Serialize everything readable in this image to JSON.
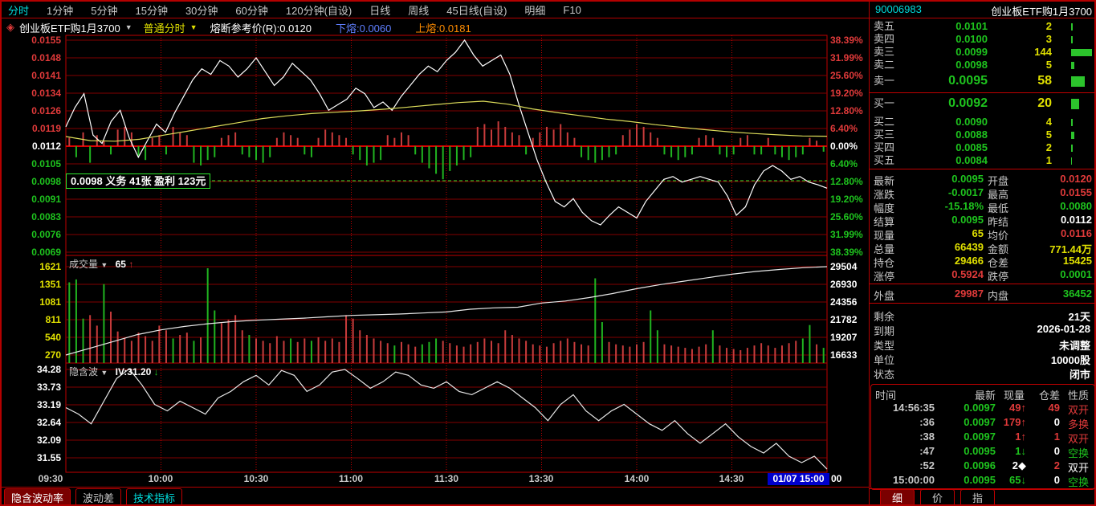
{
  "window": {
    "code": "90006983",
    "name": "创业板ETF购1月3700"
  },
  "menu": {
    "active": "分时",
    "items": [
      "分时",
      "1分钟",
      "5分钟",
      "15分钟",
      "30分钟",
      "60分钟",
      "120分钟(自设)",
      "日线",
      "周线",
      "45日线(自设)",
      "明细",
      "F10"
    ]
  },
  "icons": {
    "dropdown": "▼",
    "diamond_marker": "◈",
    "up": "↑",
    "down": "↓",
    "flat": "◆"
  },
  "chart_header": {
    "symbol": "创业板ETF购1月3700",
    "mode": "普通分时",
    "fuse_ref": "熔断参考价(R):0.0120",
    "lower_fuse": "下熔:0.0060",
    "upper_fuse": "上熔:0.0181"
  },
  "tooltip_text": "0.0098 义务 41张 盈利 123元",
  "volume_pane_label": {
    "name": "成交量",
    "value": "65",
    "arrow": "↑"
  },
  "iv_pane_label": {
    "name": "隐含波",
    "value": "IV:31.20",
    "arrow": "↓"
  },
  "time_axis": {
    "labels": [
      "09:30",
      "10:00",
      "10:30",
      "11:00",
      "11:30",
      "13:30",
      "14:00",
      "14:30"
    ],
    "end_label": "01/07 15:00",
    "end_suffix": "00"
  },
  "bottom_tabs_left": [
    {
      "label": "隐含波动率",
      "style": "active"
    },
    {
      "label": "波动差",
      "style": "normal"
    },
    {
      "label": "技术指标",
      "style": "cyan"
    }
  ],
  "bottom_tabs_right": [
    {
      "label": "细",
      "style": "active"
    },
    {
      "label": "价",
      "style": "normal"
    },
    {
      "label": "指",
      "style": "normal"
    }
  ],
  "order_book": {
    "sell_rows": [
      {
        "label": "卖五",
        "price": "0.0101",
        "vol": "2",
        "bar": 2,
        "big": false
      },
      {
        "label": "卖四",
        "price": "0.0100",
        "vol": "3",
        "bar": 2,
        "big": false
      },
      {
        "label": "卖三",
        "price": "0.0099",
        "vol": "144",
        "bar": 26,
        "big": false
      },
      {
        "label": "卖二",
        "price": "0.0098",
        "vol": "5",
        "bar": 4,
        "big": false
      },
      {
        "label": "卖一",
        "price": "0.0095",
        "vol": "58",
        "bar": 17,
        "big": true
      }
    ],
    "buy_rows": [
      {
        "label": "买一",
        "price": "0.0092",
        "vol": "20",
        "bar": 10,
        "big": true
      },
      {
        "label": "买二",
        "price": "0.0090",
        "vol": "4",
        "bar": 2,
        "big": false
      },
      {
        "label": "买三",
        "price": "0.0088",
        "vol": "5",
        "bar": 4,
        "big": false
      },
      {
        "label": "买四",
        "price": "0.0085",
        "vol": "2",
        "bar": 2,
        "big": false
      },
      {
        "label": "买五",
        "price": "0.0084",
        "vol": "1",
        "bar": 1,
        "big": false
      }
    ]
  },
  "stats_rows": [
    {
      "l1": "最新",
      "v1": "0.0095",
      "c1": "green",
      "l2": "开盘",
      "v2": "0.0120",
      "c2": "red"
    },
    {
      "l1": "涨跌",
      "v1": "-0.0017",
      "c1": "green",
      "l2": "最高",
      "v2": "0.0155",
      "c2": "red"
    },
    {
      "l1": "幅度",
      "v1": "-15.18%",
      "c1": "green",
      "l2": "最低",
      "v2": "0.0080",
      "c2": "green"
    },
    {
      "l1": "结算",
      "v1": "0.0095",
      "c1": "green",
      "l2": "昨结",
      "v2": "0.0112",
      "c2": "white"
    },
    {
      "l1": "现量",
      "v1": "65",
      "c1": "yellow",
      "l2": "均价",
      "v2": "0.0116",
      "c2": "red"
    },
    {
      "l1": "总量",
      "v1": "66439",
      "c1": "yellow",
      "l2": "金额",
      "v2": "771.44万",
      "c2": "yellow"
    },
    {
      "l1": "持仓",
      "v1": "29466",
      "c1": "yellow",
      "l2": "仓差",
      "v2": "15425",
      "c2": "yellow"
    },
    {
      "l1": "涨停",
      "v1": "0.5924",
      "c1": "red",
      "l2": "跌停",
      "v2": "0.0001",
      "c2": "green"
    }
  ],
  "lot_row": {
    "l1": "外盘",
    "v1": "29987",
    "c1": "red",
    "l2": "内盘",
    "v2": "36452",
    "c2": "green"
  },
  "info_rows": [
    {
      "label": "剩余",
      "value": "21天"
    },
    {
      "label": "到期",
      "value": "2026-01-28"
    },
    {
      "label": "类型",
      "value": "未调整"
    },
    {
      "label": "单位",
      "value": "10000股"
    },
    {
      "label": "状态",
      "value": "闭市"
    }
  ],
  "transactions": {
    "header": [
      "时间",
      "最新",
      "现量",
      "仓差",
      "性质"
    ],
    "rows": [
      {
        "time": "14:56:35",
        "price": "0.0097",
        "vol": "49",
        "arrow": "↑",
        "vc": "red",
        "diff": "49",
        "dc": "red",
        "nature": "双开",
        "nc": "red"
      },
      {
        "time": ":36",
        "price": "0.0097",
        "vol": "179",
        "arrow": "↑",
        "vc": "red",
        "diff": "0",
        "dc": "white",
        "nature": "多换",
        "nc": "red"
      },
      {
        "time": ":38",
        "price": "0.0097",
        "vol": "1",
        "arrow": "↑",
        "vc": "red",
        "diff": "1",
        "dc": "red",
        "nature": "双开",
        "nc": "red"
      },
      {
        "time": ":47",
        "price": "0.0095",
        "vol": "1",
        "arrow": "↓",
        "vc": "green",
        "diff": "0",
        "dc": "white",
        "nature": "空换",
        "nc": "green"
      },
      {
        "time": ":52",
        "price": "0.0096",
        "vol": "2",
        "arrow": "◆",
        "vc": "white",
        "diff": "2",
        "dc": "red",
        "nature": "双开",
        "nc": "white"
      },
      {
        "time": "15:00:00",
        "price": "0.0095",
        "vol": "65",
        "arrow": "↓",
        "vc": "green",
        "diff": "0",
        "dc": "white",
        "nature": "空换",
        "nc": "green"
      }
    ]
  },
  "colors": {
    "up": "#c83c3c",
    "down": "#20b420",
    "price_line": "#ffffff",
    "avg_line": "#dcdc5a",
    "oi_line": "#e8e8e8",
    "iv_line": "#e8e8e8",
    "grid": "#820000",
    "frame": "#c00000",
    "zero_line": "#e00000",
    "strike_dash": "#2ee52e",
    "highlight_bg": "#0000cc"
  },
  "chart_data": {
    "type": "line",
    "title": "创业板ETF购1月3700 普通分时",
    "x_labels": [
      "09:30",
      "10:00",
      "10:30",
      "11:00",
      "11:30",
      "13:30",
      "14:00",
      "14:30",
      "15:00"
    ],
    "price_pane": {
      "yticks_price": [
        "0.0155",
        "0.0148",
        "0.0141",
        "0.0134",
        "0.0126",
        "0.0119",
        "0.0112",
        "0.0105",
        "0.0098",
        "0.0091",
        "0.0083",
        "0.0076",
        "0.0069"
      ],
      "yticks_pct": [
        "38.39%",
        "31.99%",
        "25.60%",
        "19.20%",
        "12.80%",
        "6.40%",
        "0.00%",
        "6.40%",
        "12.80%",
        "19.20%",
        "25.60%",
        "31.99%",
        "38.39%"
      ],
      "prev_settle": 0.0112,
      "strike_line_pct": -12.5,
      "series": {
        "price_pct": [
          7,
          14,
          19,
          4,
          1,
          9,
          13,
          3,
          -4,
          2,
          8,
          5,
          12,
          18,
          24,
          28,
          26,
          31,
          29,
          25,
          28,
          32,
          27,
          22,
          25,
          30,
          27,
          24,
          19,
          13,
          15,
          17,
          21,
          19,
          14,
          16,
          13,
          18,
          22,
          26,
          29,
          27,
          31,
          34,
          38.4,
          33,
          29,
          31,
          33,
          26,
          15,
          5,
          -5,
          -13,
          -20,
          -22,
          -19,
          -24,
          -27,
          -28.5,
          -25,
          -22,
          -24,
          -26,
          -20,
          -16,
          -12,
          -11,
          -13,
          -12,
          -11,
          -12,
          -13,
          -18,
          -25,
          -22,
          -14,
          -9,
          -7,
          -9,
          -12,
          -11,
          -13,
          -14,
          -15.2
        ],
        "avg_price_pct": [
          3.5,
          2.0,
          1.8,
          2.5,
          4.0,
          5.5,
          7.0,
          8.5,
          10.0,
          11.0,
          11.8,
          12.3,
          12.8,
          13.4,
          14.2,
          15.0,
          15.8,
          16.3,
          15.2,
          13.5,
          12.2,
          11.0,
          9.8,
          8.9,
          7.8,
          6.9,
          6.0,
          5.2,
          4.6,
          4.1,
          3.7,
          3.6
        ],
        "minute_delta_pct": [
          3,
          -4,
          5,
          -6,
          4,
          2,
          -3,
          6,
          7,
          5,
          -4,
          -5,
          3,
          4,
          -3,
          7,
          5,
          4,
          -6,
          -7,
          -5,
          -4,
          3,
          4,
          5,
          -3,
          -4,
          -5,
          -6,
          -4,
          3,
          5,
          4,
          3,
          -3,
          -4,
          3,
          6,
          5,
          4,
          3,
          -3,
          -5,
          -7,
          -6,
          -5,
          4,
          3,
          5,
          4,
          -3,
          -6,
          -8,
          -10,
          -12,
          -9,
          -7,
          -5,
          -4,
          7,
          8,
          6,
          9,
          7,
          5,
          4,
          -3,
          3,
          5,
          7,
          6,
          8,
          5,
          3,
          -4,
          -5,
          -6,
          -5,
          -4,
          -3,
          4,
          6,
          8,
          7,
          5,
          3,
          -3,
          -4,
          -5,
          -4,
          -3,
          3,
          4,
          3,
          -3,
          -4,
          -3,
          3,
          4,
          -3,
          -3,
          3,
          -3,
          -4,
          -5,
          -4,
          -3,
          3,
          2,
          -2
        ]
      }
    },
    "volume_pane": {
      "yticks_volume": [
        "1621",
        "1351",
        "1081",
        "811",
        "540",
        "270"
      ],
      "yticks_open_interest": [
        "29504",
        "26930",
        "24356",
        "21782",
        "19207",
        "16633"
      ],
      "series": {
        "volume": [
          -1380,
          -1430,
          -760,
          820,
          640,
          -1350,
          880,
          540,
          420,
          380,
          520,
          460,
          380,
          640,
          560,
          -420,
          480,
          520,
          -380,
          440,
          -1621,
          -900,
          680,
          740,
          820,
          560,
          -480,
          420,
          380,
          340,
          460,
          380,
          -420,
          360,
          420,
          -380,
          440,
          380,
          420,
          360,
          820,
          760,
          560,
          480,
          420,
          380,
          340,
          -300,
          360,
          320,
          280,
          -320,
          -360,
          -420,
          380,
          340,
          300,
          280,
          320,
          360,
          420,
          380,
          340,
          560,
          480,
          420,
          380,
          320,
          300,
          280,
          340,
          380,
          420,
          360,
          320,
          300,
          -1450,
          -700,
          360,
          320,
          300,
          280,
          320,
          360,
          -900,
          -560,
          320,
          300,
          280,
          260,
          240,
          280,
          320,
          -560,
          300,
          260,
          240,
          220,
          260,
          300,
          340,
          300,
          260,
          300,
          340,
          380,
          -420,
          -650,
          320,
          -260
        ],
        "open_interest": [
          16633,
          17600,
          18600,
          19600,
          20300,
          20800,
          21200,
          21500,
          21700,
          21850,
          22000,
          22200,
          22400,
          22500,
          22600,
          22750,
          22900,
          23300,
          23500,
          23600,
          24200,
          24500,
          25000,
          25600,
          26300,
          26900,
          27400,
          27900,
          28400,
          28800,
          29100,
          29350,
          29500
        ]
      }
    },
    "iv_pane": {
      "yticks_iv": [
        "34.28",
        "33.73",
        "33.19",
        "32.64",
        "32.09",
        "31.55"
      ],
      "series": {
        "implied_volatility": [
          33.1,
          32.9,
          32.6,
          33.3,
          34.0,
          34.3,
          33.8,
          33.2,
          33.0,
          33.3,
          33.1,
          32.9,
          33.4,
          33.6,
          33.9,
          34.1,
          33.8,
          34.25,
          34.1,
          33.6,
          33.8,
          34.2,
          34.28,
          34.0,
          33.7,
          33.9,
          34.2,
          34.1,
          33.8,
          33.7,
          33.9,
          33.6,
          33.5,
          33.7,
          33.9,
          33.7,
          33.4,
          33.1,
          32.7,
          33.2,
          33.5,
          33.0,
          32.7,
          33.0,
          33.2,
          32.9,
          32.6,
          32.4,
          32.7,
          32.3,
          32.0,
          32.3,
          32.6,
          32.2,
          31.9,
          31.7,
          32.0,
          31.6,
          31.4,
          31.6,
          31.2
        ]
      }
    }
  }
}
